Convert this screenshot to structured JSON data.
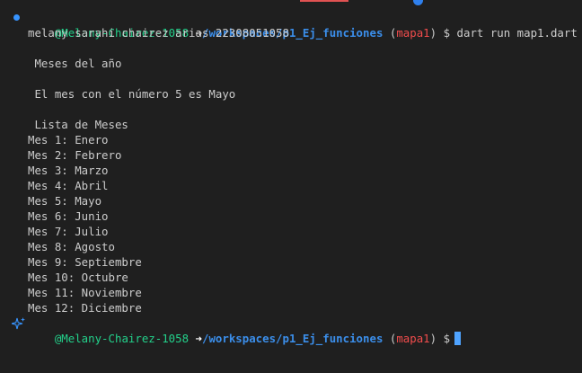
{
  "prompt": {
    "user": "@Melany-Chairez-1058",
    "arrow": "➜",
    "path": "/workspaces/p1_Ej_funciones",
    "paren_open": "(",
    "branch": "mapa1",
    "paren_close": ")",
    "dollar": "$"
  },
  "command": "dart run map1.dart",
  "output": {
    "author": "melany sarahi chairez arias 22308051058",
    "heading_months": " Meses del año",
    "month5_message": " El mes con el número 5 es Mayo",
    "list_title": " Lista de Meses",
    "months": [
      "Mes 1: Enero",
      "Mes 2: Febrero",
      "Mes 3: Marzo",
      "Mes 4: Abril",
      "Mes 5: Mayo",
      "Mes 6: Junio",
      "Mes 7: Julio",
      "Mes 8: Agosto",
      "Mes 9: Septiembre",
      "Mes 10: Octubre",
      "Mes 11: Noviembre",
      "Mes 12: Diciembre"
    ]
  },
  "icons": {
    "command_marker": "circle-dot-icon",
    "prompt_marker": "sparkle-icon"
  },
  "colors": {
    "background": "#1f1f1f",
    "user": "#23d18b",
    "path": "#3b8eea",
    "branch": "#f14c4c",
    "cursor": "#4fa3ff"
  }
}
